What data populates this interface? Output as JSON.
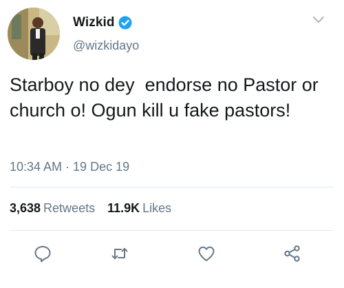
{
  "user": {
    "display_name": "Wizkid",
    "handle": "@wizkidayo",
    "verified": true,
    "avatar_icon": "profile-photo"
  },
  "tweet": {
    "text": "Starboy no dey  endorse no Pastor or church o! Ogun kill u fake pastors!",
    "timestamp": "10:34 AM · 19 Dec 19"
  },
  "stats": {
    "retweets_count": "3,638",
    "retweets_label": "Retweets",
    "likes_count": "11.9K",
    "likes_label": "Likes"
  },
  "actions": {
    "reply_icon": "reply-icon",
    "retweet_icon": "retweet-icon",
    "like_icon": "heart-icon",
    "share_icon": "share-icon"
  },
  "colors": {
    "text": "#14171a",
    "secondary_text": "#657786",
    "verified_blue": "#1da1f2",
    "divider": "#e1e8ed",
    "icon": "#657786"
  }
}
